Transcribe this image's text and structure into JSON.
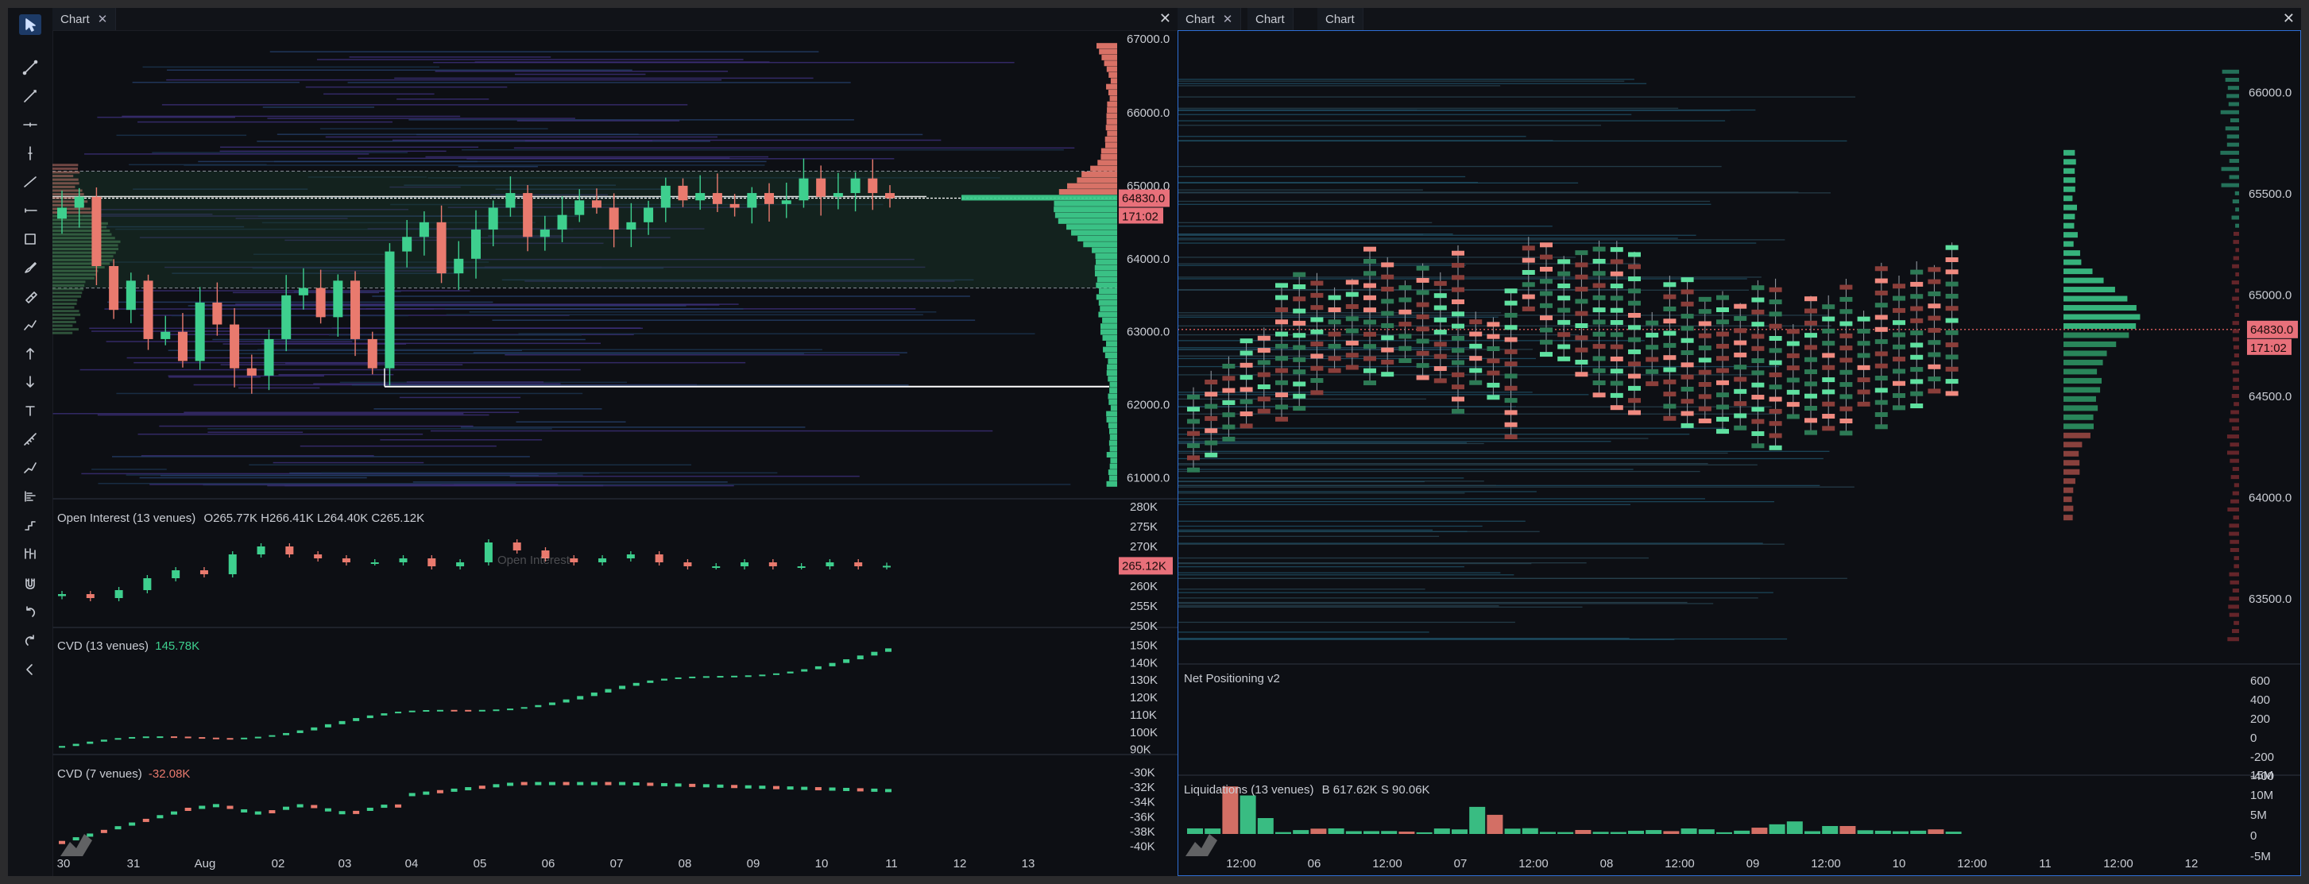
{
  "toolbar": {
    "tools": [
      "cursor-icon",
      "trend-line-icon",
      "ray-icon",
      "horizontal-line-icon",
      "vertical-line-icon",
      "line-icon",
      "horizontal-ray-icon",
      "rectangle-icon",
      "brush-icon",
      "highlighter-icon",
      "path-icon",
      "arrow-up-icon",
      "arrow-down-icon",
      "text-icon",
      "ruler-icon",
      "measure-icon",
      "volume-profile-icon",
      "long-short-icon",
      "bars-icon",
      "magnet-icon",
      "undo-icon",
      "redo-icon",
      "collapse-icon"
    ]
  },
  "left_panel": {
    "tabs": [
      {
        "label": "Chart"
      }
    ],
    "close_label": "✕",
    "price_axis": [
      "66000.0",
      "65000.0",
      "64000.0",
      "63000.0",
      "62000.0",
      "61000.0"
    ],
    "price_badge": "64830.0",
    "time_badge": "171:02",
    "time_axis": [
      "30",
      "31",
      "Aug",
      "02",
      "03",
      "04",
      "05",
      "06",
      "07",
      "08",
      "09",
      "10",
      "11",
      "12",
      "13"
    ],
    "oi": {
      "label": "Open Interest (13 venues)",
      "values": "O265.77K  H266.41K  L264.40K  C265.12K",
      "axis": [
        "280K",
        "275K",
        "270K",
        "265K",
        "260K",
        "255K",
        "250K"
      ],
      "badge": "265.12K",
      "watermark": "Open Interest"
    },
    "cvd13": {
      "label": "CVD (13 venues)",
      "value": "145.78K",
      "axis": [
        "150K",
        "140K",
        "130K",
        "120K",
        "110K",
        "100K",
        "90K"
      ]
    },
    "cvd7": {
      "label": "CVD (7 venues)",
      "value": "-32.08K",
      "axis": [
        "-30K",
        "-32K",
        "-34K",
        "-36K",
        "-38K",
        "-40K"
      ]
    }
  },
  "right_panel": {
    "tabs": [
      {
        "label": "Chart",
        "closable": true
      },
      {
        "label": "Chart"
      },
      {
        "label": "Chart"
      }
    ],
    "close_label": "✕",
    "price_axis": [
      "66000.0",
      "65500.0",
      "65000.0",
      "64500.0",
      "64000.0",
      "63500.0"
    ],
    "price_badge": "64830.0",
    "time_badge": "171:02",
    "time_axis": [
      "12:00",
      "06",
      "12:00",
      "07",
      "12:00",
      "08",
      "12:00",
      "09",
      "12:00",
      "10",
      "12:00",
      "11",
      "12:00",
      "12"
    ],
    "net_positioning": {
      "label": "Net Positioning v2",
      "axis": [
        "600",
        "400",
        "200",
        "0",
        "-200",
        "-400"
      ]
    },
    "liquidations": {
      "label": "Liquidations (13 venues)",
      "values": "B 617.62K  S 90.06K",
      "axis": [
        "15M",
        "10M",
        "5M",
        "0",
        "-5M"
      ]
    }
  },
  "colors": {
    "bull": "#3ecf8e",
    "bear": "#e97a6e",
    "accent": "#2f6fd6",
    "badge": "#e8707a",
    "background": "#0d0f14"
  },
  "chart_data": [
    {
      "type": "candlestick",
      "title": "",
      "x": [
        "30",
        "31",
        "Aug",
        "02",
        "03",
        "04",
        "05",
        "06",
        "07",
        "08",
        "09",
        "10",
        "11",
        "12",
        "13"
      ],
      "ylim": [
        60800,
        67000
      ],
      "series": [
        {
          "name": "",
          "values": [
            64700,
            64850,
            63900,
            63300,
            63700,
            62900,
            63000,
            62600,
            63400,
            63100,
            62500,
            62400,
            62900,
            63500,
            63600,
            63200,
            63700,
            62900,
            62500,
            64100,
            64300,
            64500,
            63800,
            64000,
            64400,
            64700,
            64900,
            64300,
            64400,
            64600,
            64800,
            64700,
            64400,
            64500,
            64700,
            65000,
            64800,
            64900,
            64750,
            64700,
            64900,
            64750,
            64800,
            65100,
            64850,
            64900,
            65100,
            64900,
            64830
          ]
        }
      ]
    },
    {
      "type": "line",
      "title": "",
      "series": [
        {
          "name": "Open Interest (13 venues)",
          "values": [
            258,
            257,
            259,
            262,
            264,
            263,
            268,
            270,
            268,
            267,
            266,
            266,
            267,
            265,
            266,
            271,
            269,
            267,
            266,
            267,
            268,
            266,
            265,
            265,
            266,
            265,
            265,
            266,
            265,
            265.12
          ]
        }
      ],
      "ylim": [
        250,
        280
      ]
    }
  ]
}
